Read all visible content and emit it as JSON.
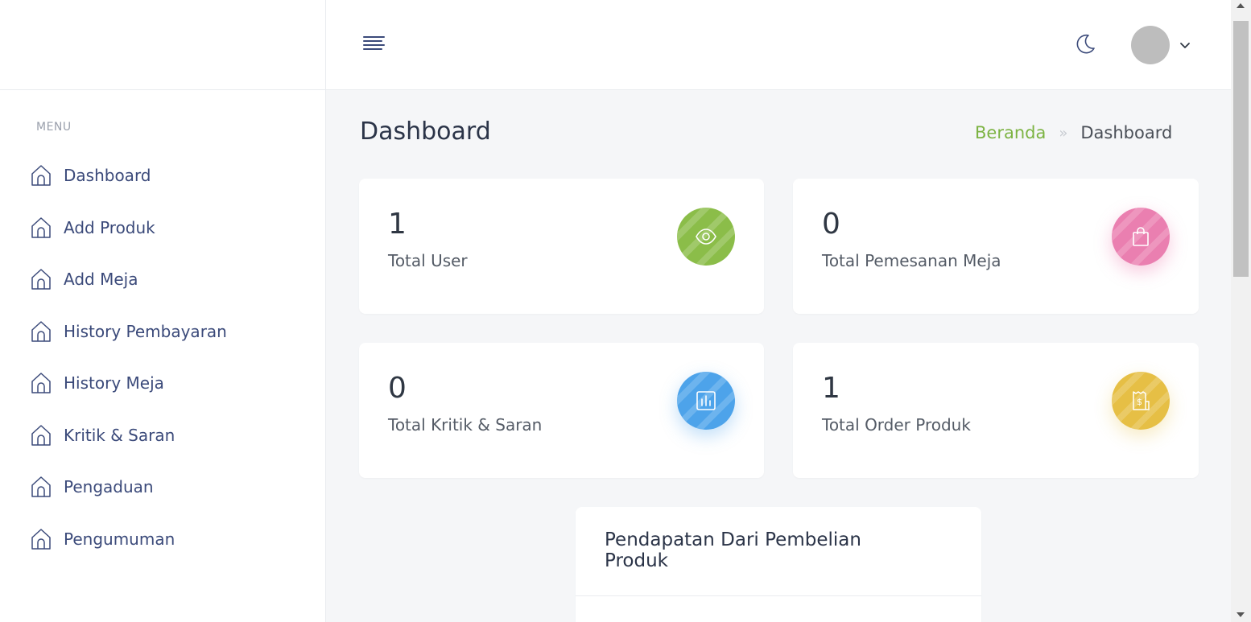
{
  "sidebar": {
    "menu_title": "MENU",
    "items": [
      {
        "label": "Dashboard",
        "icon": "home-icon"
      },
      {
        "label": "Add Produk",
        "icon": "home-icon"
      },
      {
        "label": "Add Meja",
        "icon": "home-icon"
      },
      {
        "label": "History Pembayaran",
        "icon": "home-icon"
      },
      {
        "label": "History Meja",
        "icon": "home-icon"
      },
      {
        "label": "Kritik & Saran",
        "icon": "home-icon"
      },
      {
        "label": "Pengaduan",
        "icon": "home-icon"
      },
      {
        "label": "Pengumuman",
        "icon": "home-icon"
      }
    ]
  },
  "header": {
    "menu_icon": "hamburger-icon",
    "theme_icon": "moon-icon",
    "avatar_icon": "avatar",
    "dropdown_icon": "chevron-down-icon"
  },
  "main": {
    "title": "Dashboard",
    "breadcrumb": {
      "home": "Beranda",
      "separator": "»",
      "current": "Dashboard"
    },
    "stats": [
      {
        "value": "1",
        "label": "Total User",
        "icon": "eye-icon",
        "color": "#8bbd49"
      },
      {
        "value": "0",
        "label": "Total Pemesanan Meja",
        "icon": "shopping-bag-icon",
        "color": "#ea7fb0"
      },
      {
        "value": "0",
        "label": "Total Kritik & Saran",
        "icon": "bar-chart-icon",
        "color": "#4da3ea"
      },
      {
        "value": "1",
        "label": "Total Order Produk",
        "icon": "receipt-icon",
        "color": "#e6bf45"
      }
    ],
    "chart_card": {
      "title": "Pendapatan Dari Pembelian Produk"
    }
  },
  "colors": {
    "accent_green": "#7cb342",
    "text_nav": "#3b4a7a",
    "background": "#f5f6f8"
  }
}
